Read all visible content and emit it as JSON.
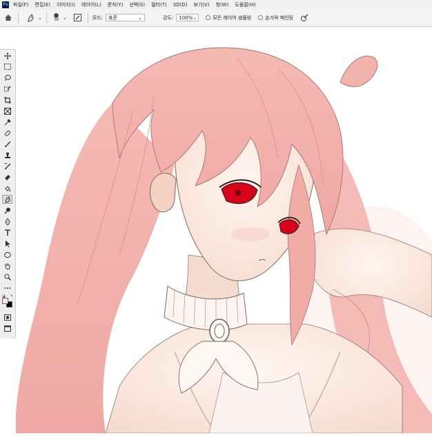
{
  "app": {
    "logo": "Ps"
  },
  "menu": {
    "items": [
      "파일(F)",
      "편집(E)",
      "이미지(I)",
      "레이어(L)",
      "문자(Y)",
      "선택(S)",
      "필터(T)",
      "3D(D)",
      "보기(V)",
      "창(W)",
      "도움말(H)"
    ]
  },
  "options": {
    "brush_size": "50",
    "mode_label": "모드:",
    "mode_value": "표준",
    "strength_label": "강도:",
    "strength_value": "100%",
    "sample_all_layers": "모든 레이어 샘플링",
    "finger_painting": "손가락 페인팅"
  },
  "toolbar": {
    "icons": [
      "move-tool-icon",
      "marquee-tool-icon",
      "lasso-tool-icon",
      "quick-select-icon",
      "crop-tool-icon",
      "frame-tool-icon",
      "eyedropper-icon",
      "healing-brush-icon",
      "brush-tool-icon",
      "clone-stamp-icon",
      "history-brush-icon",
      "eraser-icon",
      "paint-bucket-icon",
      "smudge-tool-icon",
      "dodge-tool-icon",
      "pen-tool-icon",
      "type-tool-icon",
      "path-select-icon",
      "ellipse-tool-icon",
      "hand-tool-icon",
      "zoom-tool-icon",
      "more-tools-icon",
      "color-swatches",
      "quick-mask-icon",
      "screen-mode-icon"
    ],
    "active": "smudge-tool-icon"
  },
  "colors": {
    "hair": "#f3b3ad",
    "hair_shadow": "#e8938e",
    "skin": "#fbeee6",
    "eye": "#d9001b",
    "outline": "#6b5a55",
    "foreground": "#3a1f22",
    "background": "#ffffff"
  }
}
